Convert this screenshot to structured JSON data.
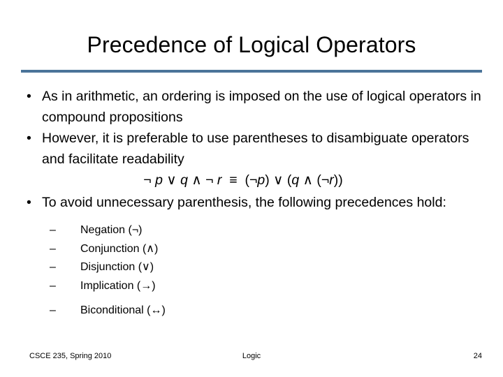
{
  "slide": {
    "title": "Precedence of Logical Operators",
    "rule_color": "#4a7499",
    "bullets": [
      {
        "marker": "•",
        "text": "As in arithmetic, an ordering is imposed on the use of logical operators in compound propositions"
      },
      {
        "marker": "•",
        "text": "However, it is preferable to use parentheses to disambiguate operators and facilitate readability"
      },
      {
        "marker": "•",
        "text": "To avoid unnecessary parenthesis, the following precedences hold:"
      }
    ],
    "formula": {
      "full": "¬ p ∨ q ∧ ¬ r  ≡  (¬p) ∨ (q ∧ (¬r))",
      "left_side": "¬ p ∨ q ∧ ¬ r",
      "relation": "≡",
      "right_side": "(¬p) ∨ (q ∧ (¬r))",
      "parts": {
        "neg1": "¬",
        "p": "p",
        "or1": "∨",
        "q1": "q",
        "and1": "∧",
        "neg2": "¬",
        "r": "r",
        "equiv": "≡",
        "lparen1": "(",
        "neg3": "¬",
        "p2": "p",
        "rparen1": ")",
        "or2": "∨",
        "lparen2": "(",
        "q2": "q",
        "and2": "∧",
        "lparen3": "(",
        "neg4": "¬",
        "r2": "r",
        "rparen2": ")",
        "rparen3": ")"
      }
    },
    "precedence_list": [
      {
        "marker": "–",
        "text": "Negation (¬)"
      },
      {
        "marker": "–",
        "text": "Conjunction (∧)"
      },
      {
        "marker": "–",
        "text": "Disjunction (∨)"
      },
      {
        "marker": "–",
        "text": "Implication (→)"
      },
      {
        "marker": "–",
        "text": "Biconditional (↔)"
      }
    ],
    "footer": {
      "left": "CSCE 235, Spring 2010",
      "center": "Logic",
      "right": "24"
    }
  }
}
